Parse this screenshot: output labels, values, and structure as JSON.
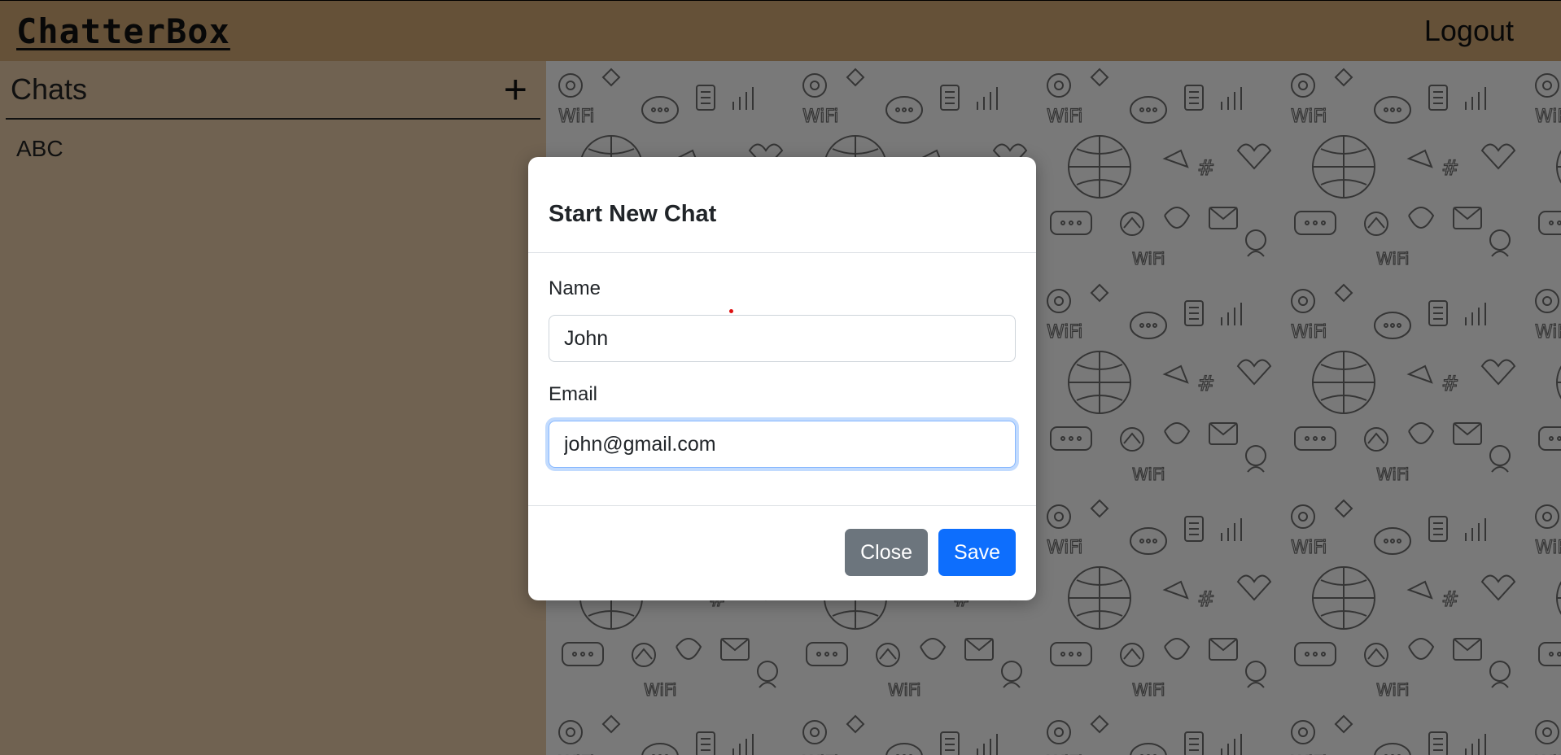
{
  "navbar": {
    "brand": "ChatterBox",
    "logout_label": "Logout"
  },
  "sidebar": {
    "title": "Chats",
    "add_symbol": "+",
    "chats": [
      {
        "name": "ABC"
      }
    ]
  },
  "chat_area": {
    "background_pattern": "doodle-icons"
  },
  "modal": {
    "title": "Start New Chat",
    "name_label": "Name",
    "name_value": "John",
    "email_label": "Email",
    "email_value": "john@gmail.com",
    "close_label": "Close",
    "save_label": "Save"
  },
  "colors": {
    "navbar_bg": "#cba370",
    "sidebar_bg": "#e0c5a3",
    "primary": "#0d6efd",
    "secondary": "#6c757d"
  }
}
